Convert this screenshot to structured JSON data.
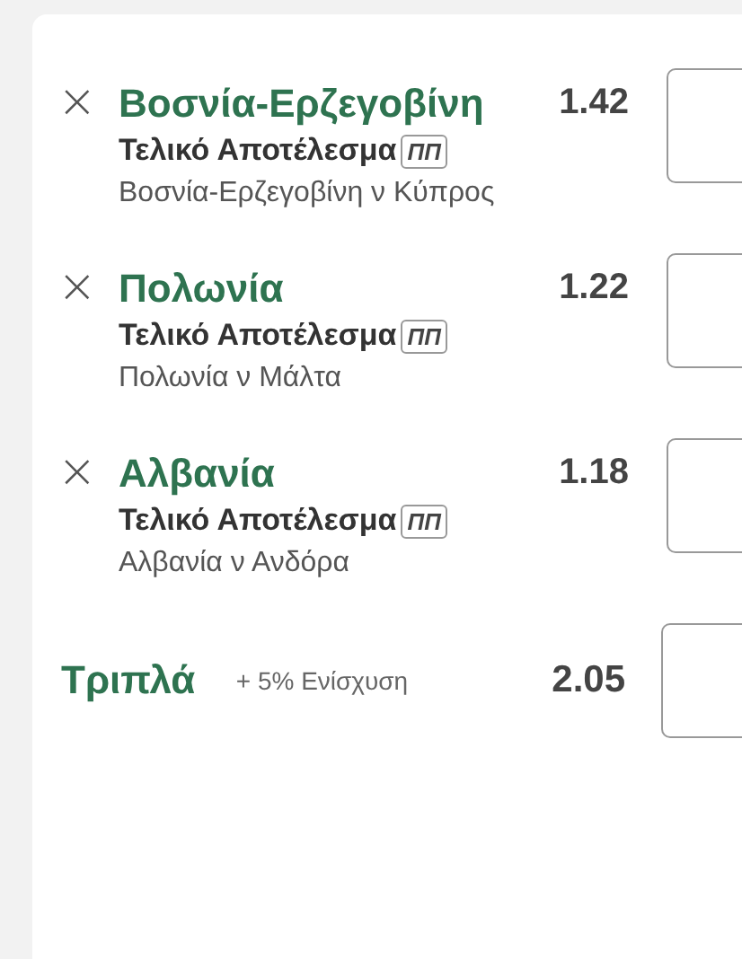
{
  "selections": [
    {
      "team": "Βοσνία-Ερζεγοβίνη",
      "odds": "1.42",
      "market": "Τελικό Αποτέλεσμα",
      "badge": "ΠΠ",
      "event": "Βοσνία-Ερζεγοβίνη ν Κύπρος",
      "remove": "×"
    },
    {
      "team": "Πολωνία",
      "odds": "1.22",
      "market": "Τελικό Αποτέλεσμα",
      "badge": "ΠΠ",
      "event": "Πολωνία ν Μάλτα",
      "remove": "×"
    },
    {
      "team": "Αλβανία",
      "odds": "1.18",
      "market": "Τελικό Αποτέλεσμα",
      "badge": "ΠΠ",
      "event": "Αλβανία ν Ανδόρα",
      "remove": "×"
    }
  ],
  "multiple": {
    "name": "Τριπλά",
    "boost": "+ 5% Ενίσχυση",
    "odds": "2.05"
  }
}
